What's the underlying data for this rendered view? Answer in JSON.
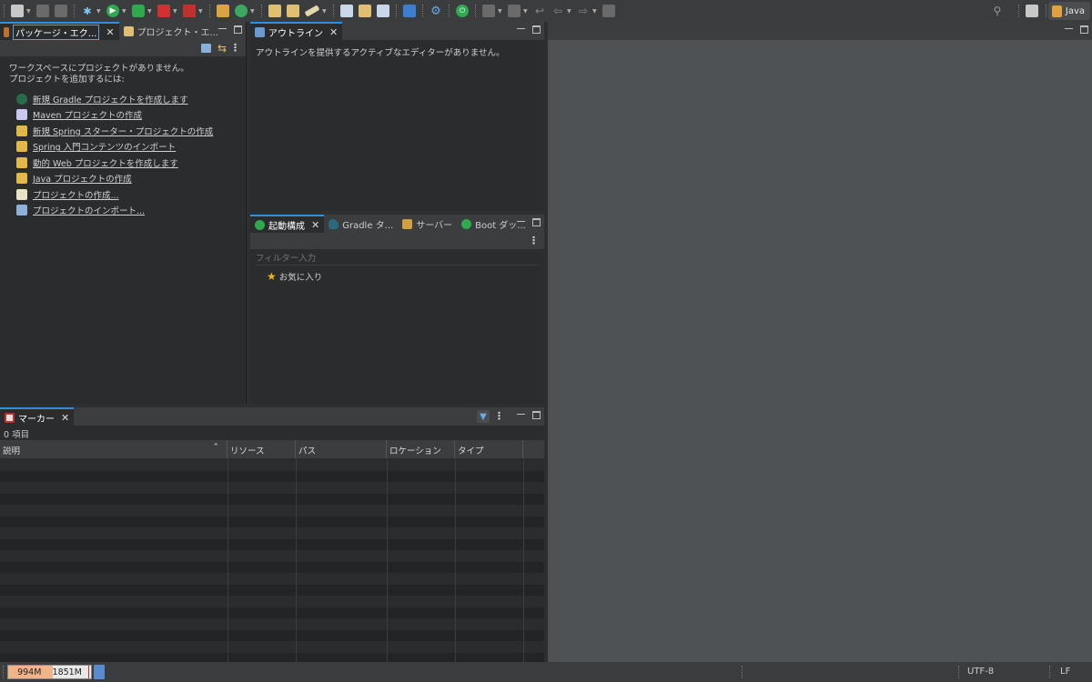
{
  "toolbar": {
    "icons": [
      "new-icon",
      "save-icon",
      "save-all-icon",
      "debug-icon",
      "run-icon",
      "run-coverage-icon",
      "stop-icon",
      "external-tools-icon",
      "new-package-icon",
      "new-class-icon",
      "open-type-icon",
      "open-task-icon",
      "search-icon",
      "annotation-icon",
      "next-annotation-icon",
      "back-icon",
      "forward-icon"
    ],
    "perspective_label": "Java"
  },
  "package_explorer": {
    "tabs": [
      {
        "label": "パッケージ・エク...",
        "active": true
      },
      {
        "label": "プロジェクト・エ...",
        "active": false
      }
    ],
    "empty_line1": "ワークスペースにプロジェクトがありません。",
    "empty_line2": "プロジェクトを追加するには:",
    "links": [
      {
        "label": "新規 Gradle プロジェクトを作成します",
        "icon": "gradle-project-icon",
        "color": "#2a6a4a"
      },
      {
        "label": "Maven プロジェクトの作成",
        "icon": "maven-project-icon",
        "color": "#c9c9f0"
      },
      {
        "label": "新規 Spring スターター・プロジェクトの作成",
        "icon": "spring-starter-icon",
        "color": "#e2b84a"
      },
      {
        "label": "Spring 入門コンテンツのインポート",
        "icon": "spring-import-icon",
        "color": "#e2b84a"
      },
      {
        "label": "動的 Web プロジェクトを作成します",
        "icon": "web-project-icon",
        "color": "#e2b84a"
      },
      {
        "label": "Java プロジェクトの作成",
        "icon": "java-project-icon",
        "color": "#e2b84a"
      },
      {
        "label": "プロジェクトの作成...",
        "icon": "new-project-icon",
        "color": "#e8e2c8"
      },
      {
        "label": "プロジェクトのインポート...",
        "icon": "import-project-icon",
        "color": "#8fb0d8"
      }
    ]
  },
  "outline": {
    "tab_label": "アウトライン",
    "message": "アウトラインを提供するアクティブなエディターがありません。"
  },
  "launch": {
    "tabs": [
      {
        "label": "起動構成",
        "active": true,
        "icon": "launch-config-icon"
      },
      {
        "label": "Gradle タ...",
        "active": false,
        "icon": "gradle-icon"
      },
      {
        "label": "サーバー",
        "active": false,
        "icon": "server-icon"
      },
      {
        "label": "Boot ダッ...",
        "active": false,
        "icon": "boot-dashboard-icon"
      }
    ],
    "filter_placeholder": "フィルター入力",
    "favorites_label": "お気に入り"
  },
  "markers": {
    "tab_label": "マーカー",
    "count": "0 項目",
    "columns": [
      "説明",
      "リソース",
      "パス",
      "ロケーション",
      "タイプ"
    ],
    "row_count": 18
  },
  "status": {
    "heap_used": "994M",
    "heap_total": "1851M",
    "heap_used_fraction": 0.537,
    "encoding": "UTF-8",
    "line_ending": "LF"
  }
}
